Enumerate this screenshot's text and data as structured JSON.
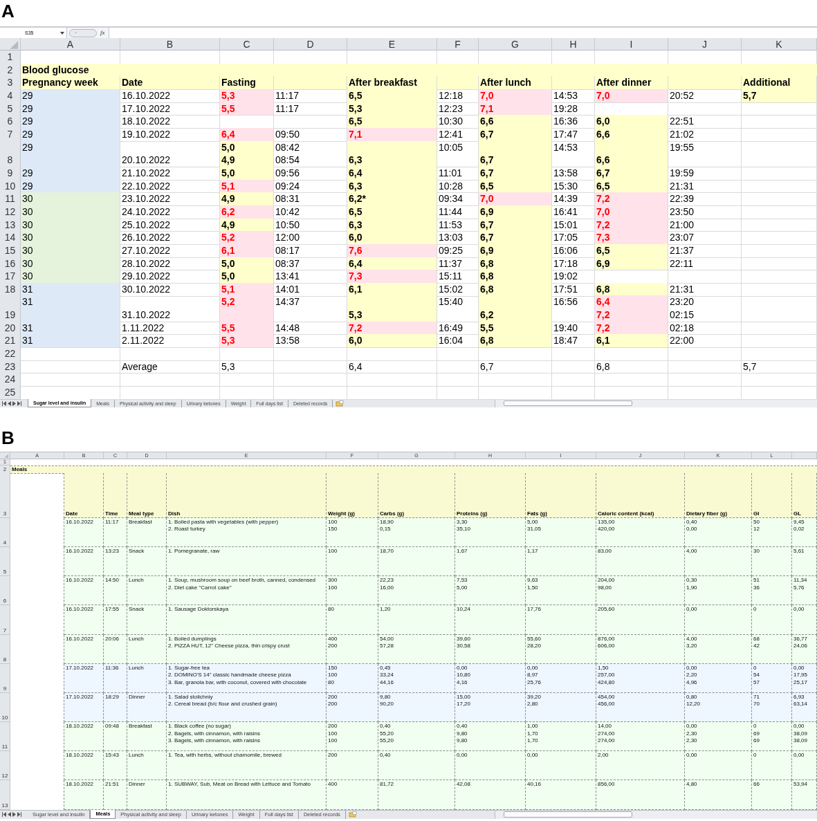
{
  "panel_a": {
    "label": "A",
    "name_box": "S35",
    "fx": "fx",
    "columns": [
      "A",
      "B",
      "C",
      "D",
      "E",
      "F",
      "G",
      "H",
      "I",
      "J",
      "K"
    ],
    "rows": [
      {
        "n": "1",
        "kind": "blank"
      },
      {
        "n": "2",
        "kind": "title",
        "title": "Blood glucose"
      },
      {
        "n": "3",
        "kind": "header",
        "week": "Pregnancy week",
        "date": "Date",
        "fasting": "Fasting",
        "breakfast": "After breakfast",
        "lunch": "After lunch",
        "dinner": "After dinner",
        "additional": "Additional"
      },
      {
        "n": "4",
        "kind": "data",
        "week": "29",
        "color": "#dde9f7",
        "date": "16.10.2022",
        "fasting": {
          "value": "5,3",
          "high": true,
          "time": "11:17"
        },
        "breakfast": {
          "value": "6,5",
          "high": false,
          "time": "12:18"
        },
        "lunch": {
          "value": "7,0",
          "high": true,
          "time": "14:53"
        },
        "dinner": {
          "value": "7,0",
          "high": true,
          "time": "20:52"
        },
        "additional": {
          "value": "5,7",
          "high": false
        }
      },
      {
        "n": "5",
        "kind": "data",
        "week": "29",
        "color": "#dde9f7",
        "date": "17.10.2022",
        "fasting": {
          "value": "5,5",
          "high": true,
          "time": "11:17"
        },
        "breakfast": {
          "value": "5,3",
          "high": false,
          "time": "12:23"
        },
        "lunch": {
          "value": "7,1",
          "high": true,
          "time": "19:28"
        }
      },
      {
        "n": "6",
        "kind": "data",
        "week": "29",
        "color": "#dde9f7",
        "date": "18.10.2022",
        "breakfast": {
          "value": "6,5",
          "high": false,
          "time": "10:30"
        },
        "lunch": {
          "value": "6,6",
          "high": false,
          "time": "16:36"
        },
        "dinner": {
          "value": "6,0",
          "high": false,
          "time": "22:51"
        }
      },
      {
        "n": "7",
        "kind": "data",
        "week": "29",
        "color": "#dde9f7",
        "date": "19.10.2022",
        "fasting": {
          "value": "6,4",
          "high": true,
          "time": "09:50"
        },
        "breakfast": {
          "value": "7,1",
          "high": true,
          "time": "12:41"
        },
        "lunch": {
          "value": "6,7",
          "high": false,
          "time": "17:47"
        },
        "dinner": {
          "value": "6,6",
          "high": false,
          "time": "21:02"
        }
      },
      {
        "n": "8",
        "kind": "data",
        "double": true,
        "week": "29",
        "color": "#dde9f7",
        "date": "20.10.2022",
        "fasting": {
          "value": "5,0\n4,9",
          "high": false,
          "time": "08:42\n08:54"
        },
        "breakfast": {
          "value": "6,3",
          "high": false,
          "top": false,
          "time": "10:05"
        },
        "lunch": {
          "value": "6,7",
          "high": false,
          "top": false,
          "time": "14:53"
        },
        "dinner": {
          "value": "6,6",
          "high": false,
          "top": false,
          "time": "19:55"
        }
      },
      {
        "n": "9",
        "kind": "data",
        "week": "29",
        "color": "#dde9f7",
        "date": "21.10.2022",
        "fasting": {
          "value": "5,0",
          "high": false,
          "time": "09:56"
        },
        "breakfast": {
          "value": "6,4",
          "high": false,
          "time": "11:01"
        },
        "lunch": {
          "value": "6,7",
          "high": false,
          "time": "13:58"
        },
        "dinner": {
          "value": "6,7",
          "high": false,
          "time": "19:59"
        }
      },
      {
        "n": "10",
        "kind": "data",
        "week": "29",
        "color": "#dde9f7",
        "date": "22.10.2022",
        "fasting": {
          "value": "5,1",
          "high": true,
          "time": "09:24"
        },
        "breakfast": {
          "value": "6,3",
          "high": false,
          "time": "10:28"
        },
        "lunch": {
          "value": "6,5",
          "high": false,
          "time": "15:30"
        },
        "dinner": {
          "value": "6,5",
          "high": false,
          "time": "21:31"
        }
      },
      {
        "n": "11",
        "kind": "data",
        "week": "30",
        "color": "#e5f2dc",
        "date": "23.10.2022",
        "fasting": {
          "value": "4,9",
          "high": false,
          "time": "08:31"
        },
        "breakfast": {
          "value": "6,2*",
          "high": false,
          "time": "09:34"
        },
        "lunch": {
          "value": "7,0",
          "high": true,
          "time": "14:39"
        },
        "dinner": {
          "value": "7,2",
          "high": true,
          "time": "22:39"
        }
      },
      {
        "n": "12",
        "kind": "data",
        "week": "30",
        "color": "#e5f2dc",
        "date": "24.10.2022",
        "fasting": {
          "value": "6,2",
          "high": true,
          "time": "10:42"
        },
        "breakfast": {
          "value": "6,5",
          "high": false,
          "time": "11:44"
        },
        "lunch": {
          "value": "6,9",
          "high": false,
          "time": "16:41"
        },
        "dinner": {
          "value": "7,0",
          "high": true,
          "time": "23:50"
        }
      },
      {
        "n": "13",
        "kind": "data",
        "week": "30",
        "color": "#e5f2dc",
        "date": "25.10.2022",
        "fasting": {
          "value": "4,9",
          "high": false,
          "time": "10:50"
        },
        "breakfast": {
          "value": "6,3",
          "high": false,
          "time": "11:53"
        },
        "lunch": {
          "value": "6,7",
          "high": false,
          "time": "15:01"
        },
        "dinner": {
          "value": "7,2",
          "high": true,
          "time": "21:00"
        }
      },
      {
        "n": "14",
        "kind": "data",
        "week": "30",
        "color": "#e5f2dc",
        "date": "26.10.2022",
        "fasting": {
          "value": "5,2",
          "high": true,
          "time": "12:00"
        },
        "breakfast": {
          "value": "6,0",
          "high": false,
          "time": "13:03"
        },
        "lunch": {
          "value": "6,7",
          "high": false,
          "time": "17:05"
        },
        "dinner": {
          "value": "7,3",
          "high": true,
          "time": "23:07"
        }
      },
      {
        "n": "15",
        "kind": "data",
        "week": "30",
        "color": "#e5f2dc",
        "date": "27.10.2022",
        "fasting": {
          "value": "6,1",
          "high": true,
          "time": "08:17"
        },
        "breakfast": {
          "value": "7,6",
          "high": true,
          "time": "09:25"
        },
        "lunch": {
          "value": "6,9",
          "high": false,
          "time": "16:06"
        },
        "dinner": {
          "value": "6,5",
          "high": false,
          "time": "21:37"
        }
      },
      {
        "n": "16",
        "kind": "data",
        "week": "30",
        "color": "#e5f2dc",
        "date": "28.10.2022",
        "fasting": {
          "value": "5,0",
          "high": false,
          "time": "08:37"
        },
        "breakfast": {
          "value": "6,4",
          "high": false,
          "time": "11:37"
        },
        "lunch": {
          "value": "6,8",
          "high": false,
          "time": "17:18"
        },
        "dinner": {
          "value": "6,9",
          "high": false,
          "time": "22:11"
        }
      },
      {
        "n": "17",
        "kind": "data",
        "week": "30",
        "color": "#e5f2dc",
        "date": "29.10.2022",
        "fasting": {
          "value": "5,0",
          "high": false,
          "time": "13:41"
        },
        "breakfast": {
          "value": "7,3",
          "high": true,
          "time": "15:11"
        },
        "lunch": {
          "value": "6,8",
          "high": false,
          "time": "19:02"
        }
      },
      {
        "n": "18",
        "kind": "data",
        "week": "31",
        "color": "#dde9f7",
        "date": "30.10.2022",
        "fasting": {
          "value": "5,1",
          "high": true,
          "time": "14:01"
        },
        "breakfast": {
          "value": "6,1",
          "high": false,
          "time": "15:02"
        },
        "lunch": {
          "value": "6,8",
          "high": false,
          "time": "17:51"
        },
        "dinner": {
          "value": "6,8",
          "high": false,
          "time": "21:31"
        }
      },
      {
        "n": "19",
        "kind": "data",
        "double": true,
        "week": "31",
        "color": "#dde9f7",
        "date": "31.10.2022",
        "fasting": {
          "value": "5,2",
          "high": true,
          "top": true,
          "time": "14:37"
        },
        "breakfast": {
          "value": "5,3",
          "high": false,
          "top": false,
          "time": "15:40"
        },
        "lunch": {
          "value": "6,2",
          "high": false,
          "top": false,
          "time": "16:56"
        },
        "dinner": {
          "value": "6,4\n7,2",
          "high": true,
          "time": "23:20\n02:15"
        }
      },
      {
        "n": "20",
        "kind": "data",
        "week": "31",
        "color": "#dde9f7",
        "date": "1.11.2022",
        "fasting": {
          "value": "5,5",
          "high": true,
          "time": "14:48"
        },
        "breakfast": {
          "value": "7,2",
          "high": true,
          "time": "16:49"
        },
        "lunch": {
          "value": "5,5",
          "high": false,
          "time": "19:40"
        },
        "dinner": {
          "value": "7,2",
          "high": true,
          "time": "02:18"
        }
      },
      {
        "n": "21",
        "kind": "data",
        "week": "31",
        "color": "#dde9f7",
        "date": "2.11.2022",
        "fasting": {
          "value": "5,3",
          "high": true,
          "time": "13:58"
        },
        "breakfast": {
          "value": "6,0",
          "high": false,
          "time": "16:04"
        },
        "lunch": {
          "value": "6,8",
          "high": false,
          "time": "18:47"
        },
        "dinner": {
          "value": "6,1",
          "high": false,
          "time": "22:00"
        }
      },
      {
        "n": "22",
        "kind": "blank"
      },
      {
        "n": "23",
        "kind": "average",
        "label": "Average",
        "fasting": "5,3",
        "breakfast": "6,4",
        "lunch": "6,7",
        "dinner": "6,8",
        "additional": "5,7"
      },
      {
        "n": "24",
        "kind": "blank"
      },
      {
        "n": "25",
        "kind": "blank"
      }
    ],
    "tabs": [
      {
        "label": "Sugar level and insulin",
        "selected": true
      },
      {
        "label": "Meals",
        "selected": false
      },
      {
        "label": "Physical activity and sleep",
        "selected": false
      },
      {
        "label": "Urinary ketones",
        "selected": false
      },
      {
        "label": "Weight",
        "selected": false
      },
      {
        "label": "Full days list",
        "selected": false
      },
      {
        "label": "Deleted records",
        "selected": false
      }
    ]
  },
  "panel_b": {
    "label": "B",
    "columns": [
      "A",
      "B",
      "C",
      "D",
      "E",
      "F",
      "G",
      "H",
      "I",
      "J",
      "K",
      "L"
    ],
    "row_numbers": {
      "blank": "1",
      "title": "2",
      "header": "3"
    },
    "title": "Meals",
    "headers": [
      "Date",
      "Time",
      "Meal type",
      "Dish",
      "Weight (g)",
      "Carbs (g)",
      "Proteins (g)",
      "Fats (g)",
      "Caloric content (kcal)",
      "Dietary fiber (g)",
      "GI",
      "GL"
    ],
    "rows": [
      {
        "n": "4",
        "color": "#f0fff0",
        "date": "16.10.2022",
        "time": "11:17",
        "meal_type": "Breakfast",
        "items": [
          [
            "1. Boiled pasta with vegetables (with pepper)",
            "100",
            "18,90",
            "3,30",
            "5,00",
            "135,00",
            "0,40",
            "50",
            "9,45"
          ],
          [
            "2. Roast turkey",
            "150",
            "0,15",
            "35,10",
            "31,05",
            "420,00",
            "0,00",
            "12",
            "0,02"
          ]
        ]
      },
      {
        "n": "5",
        "color": "#f0fff0",
        "date": "16.10.2022",
        "time": "13:23",
        "meal_type": "Snack",
        "items": [
          [
            "1. Pomegranate, raw",
            "100",
            "18,70",
            "1,67",
            "1,17",
            "83,00",
            "4,00",
            "30",
            "5,61"
          ]
        ]
      },
      {
        "n": "6",
        "color": "#f0fff0",
        "date": "16.10.2022",
        "time": "14:50",
        "meal_type": "Lunch",
        "items": [
          [
            "1. Soup, mushroom soup on beef broth, canned, condensed",
            "300",
            "22,23",
            "7,53",
            "9,63",
            "204,00",
            "0,30",
            "51",
            "11,34"
          ],
          [
            "2. Diet cake \"Carrot cake\"",
            "100",
            "16,00",
            "5,00",
            "1,50",
            "98,00",
            "1,90",
            "36",
            "5,76"
          ]
        ]
      },
      {
        "n": "7",
        "color": "#f0fff0",
        "date": "16.10.2022",
        "time": "17:55",
        "meal_type": "Snack",
        "items": [
          [
            "1. Sausage Doktorskaya",
            "80",
            "1,20",
            "10,24",
            "17,76",
            "205,60",
            "0,00",
            "0",
            "0,00"
          ]
        ]
      },
      {
        "n": "8",
        "color": "#f0fff0",
        "date": "16.10.2022",
        "time": "20:06",
        "meal_type": "Lunch",
        "items": [
          [
            "1. Boiled dumplings",
            "400",
            "54,00",
            "39,60",
            "55,60",
            "876,00",
            "4,00",
            "68",
            "36,77"
          ],
          [
            "2. PIZZA HUT, 12\" Cheese pizza, thin crispy crust",
            "200",
            "57,28",
            "30,58",
            "28,20",
            "606,00",
            "3,20",
            "42",
            "24,06"
          ]
        ]
      },
      {
        "n": "9",
        "color": "#eef6ff",
        "date": "17.10.2022",
        "time": "11:36",
        "meal_type": "Lunch",
        "items": [
          [
            "1. Sugar-free tea",
            "150",
            "0,45",
            "0,00",
            "0,00",
            "1,50",
            "0,00",
            "0",
            "0,00"
          ],
          [
            "2. DOMINO'S 14\" classic handmade cheese pizza",
            "100",
            "33,24",
            "10,80",
            "8,97",
            "257,00",
            "2,20",
            "54",
            "17,95"
          ],
          [
            "3. Bar, granola bar, with coconut, covered with chocolate",
            "80",
            "44,16",
            "4,16",
            "25,76",
            "424,80",
            "4,96",
            "57",
            "25,17"
          ]
        ]
      },
      {
        "n": "10",
        "color": "#eef6ff",
        "date": "17.10.2022",
        "time": "18:29",
        "meal_type": "Dinner",
        "items": [
          [
            "1. Salad stolichniy",
            "200",
            "9,80",
            "15,00",
            "39,20",
            "454,00",
            "0,80",
            "71",
            "6,93"
          ],
          [
            "2. Cereal bread (b/c flour and crushed grain)",
            "200",
            "90,20",
            "17,20",
            "2,80",
            "456,00",
            "12,20",
            "70",
            "63,14"
          ]
        ]
      },
      {
        "n": "11",
        "color": "#f0fff0",
        "date": "18.10.2022",
        "time": "09:48",
        "meal_type": "Breakfast",
        "items": [
          [
            "1. Black coffee (no sugar)",
            "200",
            "0,40",
            "0,40",
            "1,00",
            "14,00",
            "0,00",
            "0",
            "0,00"
          ],
          [
            "2. Bagels, with cinnamon, with raisins",
            "100",
            "55,20",
            "9,80",
            "1,70",
            "274,00",
            "2,30",
            "69",
            "38,09"
          ],
          [
            "3. Bagels, with cinnamon, with raisins",
            "100",
            "55,20",
            "9,80",
            "1,70",
            "274,00",
            "2,30",
            "69",
            "38,09"
          ]
        ]
      },
      {
        "n": "12",
        "color": "#f0fff0",
        "date": "18.10.2022",
        "time": "15:43",
        "meal_type": "Lunch",
        "items": [
          [
            "1. Tea, with herbs, without chamomile, brewed",
            "200",
            "0,40",
            "0,00",
            "0,00",
            "2,00",
            "0,00",
            "0",
            "0,00"
          ]
        ]
      },
      {
        "n": "13",
        "color": "#f0fff0",
        "date": "18.10.2022",
        "time": "21:51",
        "meal_type": "Dinner",
        "items": [
          [
            "1. SUBWAY, Sub, Meat on Bread with Lettuce and Tomato",
            "400",
            "81,72",
            "42,08",
            "40,16",
            "856,00",
            "4,80",
            "66",
            "53,94"
          ]
        ]
      }
    ],
    "tabs": [
      {
        "label": "Sugar level and insulin",
        "selected": false
      },
      {
        "label": "Meals",
        "selected": true
      },
      {
        "label": "Physical activity and sleep",
        "selected": false
      },
      {
        "label": "Urinary ketones",
        "selected": false
      },
      {
        "label": "Weight",
        "selected": false
      },
      {
        "label": "Full days list",
        "selected": false
      },
      {
        "label": "Deleted records",
        "selected": false
      }
    ]
  }
}
